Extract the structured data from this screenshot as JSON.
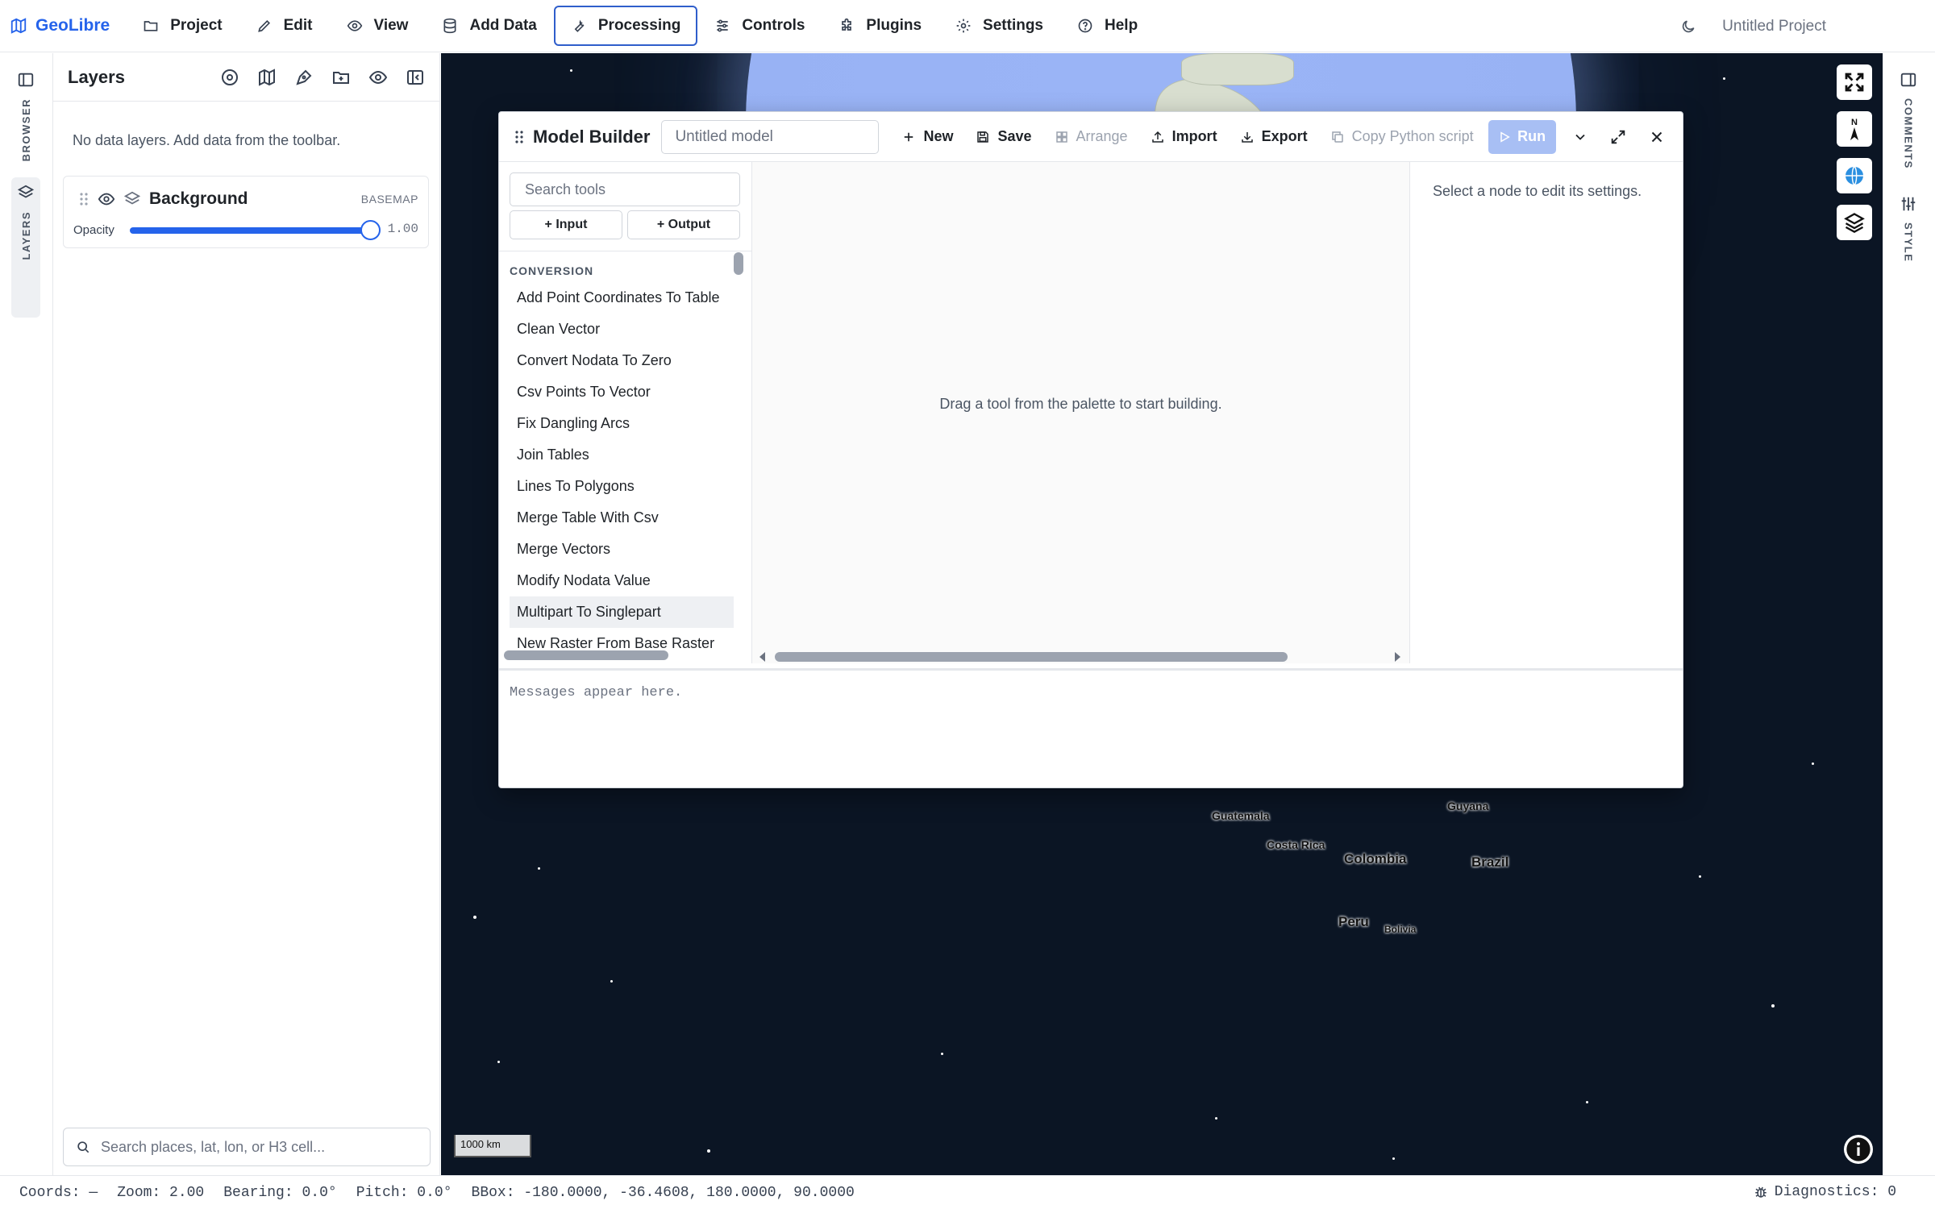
{
  "app": {
    "name": "GeoLibre",
    "project_name": "Untitled Project"
  },
  "menu": [
    "Project",
    "Edit",
    "View",
    "Add Data",
    "Processing",
    "Controls",
    "Plugins",
    "Settings",
    "Help"
  ],
  "menu_active": "Processing",
  "left_rail": {
    "browser": "BROWSER",
    "layers": "LAYERS"
  },
  "right_rail": {
    "comments": "COMMENTS",
    "style": "STYLE"
  },
  "layers_panel": {
    "title": "Layers",
    "empty_message": "No data layers. Add data from the toolbar.",
    "basemap": {
      "name": "Background",
      "badge": "BASEMAP",
      "opacity_label": "Opacity",
      "opacity_value": "1.00",
      "opacity": 1.0
    },
    "search_placeholder": "Search places, lat, lon, or H3 cell..."
  },
  "map": {
    "scale": "1000 km",
    "labels": [
      "Guatemala",
      "Costa Rica",
      "Colombia",
      "Guyana",
      "Brazil",
      "Peru",
      "Bolivia"
    ],
    "compass_label": "N"
  },
  "model_builder": {
    "title": "Model Builder",
    "name_placeholder": "Untitled model",
    "toolbar": {
      "new": "New",
      "save": "Save",
      "arrange": "Arrange",
      "import": "Import",
      "export": "Export",
      "copy_python": "Copy Python script",
      "run": "Run"
    },
    "palette": {
      "search_placeholder": "Search tools",
      "add_input": "+ Input",
      "add_output": "+ Output",
      "category": "CONVERSION",
      "tools": [
        "Add Point Coordinates To Table",
        "Clean Vector",
        "Convert Nodata To Zero",
        "Csv Points To Vector",
        "Fix Dangling Arcs",
        "Join Tables",
        "Lines To Polygons",
        "Merge Table With Csv",
        "Merge Vectors",
        "Modify Nodata Value",
        "Multipart To Singlepart",
        "New Raster From Base Raster"
      ],
      "selected_tool": "Multipart To Singlepart"
    },
    "canvas_hint": "Drag a tool from the palette to start building.",
    "properties_hint": "Select a node to edit its settings.",
    "messages_placeholder": "Messages appear here."
  },
  "status": {
    "coords": "Coords: —",
    "zoom": "Zoom: 2.00",
    "bearing": "Bearing: 0.0°",
    "pitch": "Pitch: 0.0°",
    "bbox": "BBox: -180.0000, -36.4608, 180.0000, 90.0000",
    "diagnostics": "Diagnostics: 0"
  },
  "colors": {
    "accent": "#2563eb",
    "run_disabled": "#a8bff4",
    "map_space": "#0b1524",
    "ocean": "#9ab4f6"
  }
}
